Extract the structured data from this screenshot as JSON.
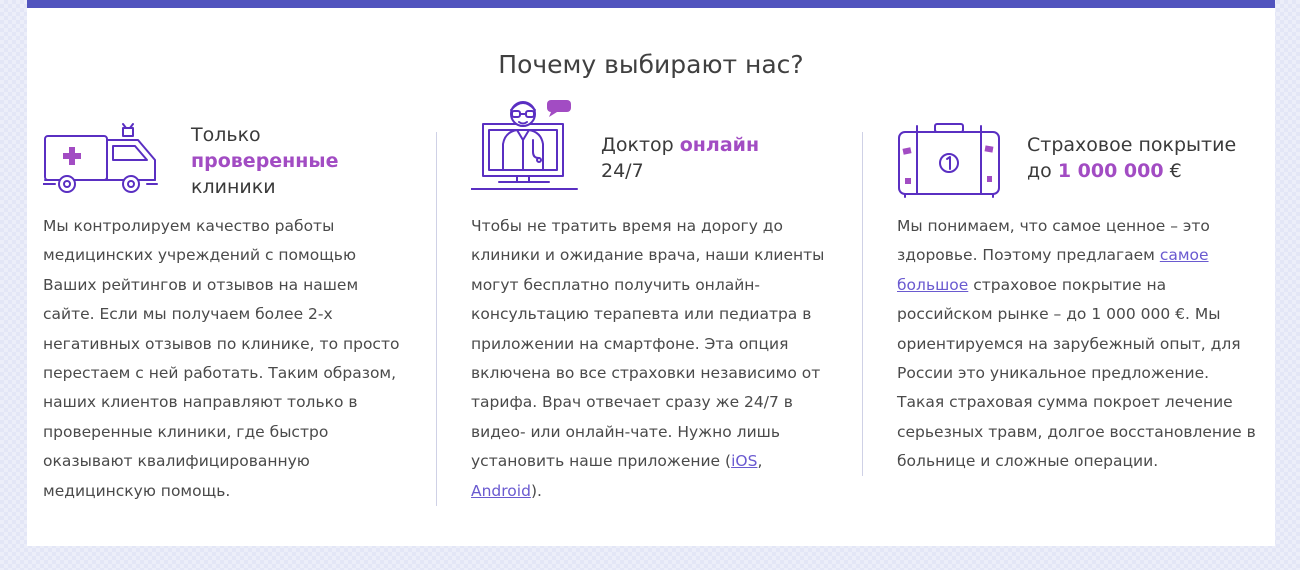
{
  "section": {
    "title": "Почему выбирают нас?"
  },
  "features": [
    {
      "icon": "ambulance-icon",
      "title_line1": "Только",
      "title_accent": "проверенные",
      "title_line3": "клиники",
      "lines": [
        "Мы контролируем качество работы",
        "медицинских учреждений с помощью",
        "Ваших рейтингов и отзывов на нашем",
        "сайте. Если мы получаем более 2-х",
        "негативных отзывов по клинике, то просто",
        "перестаем с ней работать. Таким образом,",
        "наших клиентов направляют только в",
        "проверенные клиники, где быстро",
        "оказывают квалифицированную",
        "медицинскую помощь."
      ]
    },
    {
      "icon": "doctor-monitor-icon",
      "title_plain": "Доктор ",
      "title_accent": "онлайн",
      "title_line2": "24/7",
      "lines": [
        "Чтобы не тратить время на дорогу до",
        "клиники и ожидание врача, наши клиенты",
        "могут бесплатно получить онлайн-",
        "консультацию терапевта или педиатра в",
        "приложении на смартфоне. Эта опция",
        "включена во все страховки независимо от",
        "тарифа. Врач отвечает сразу же 24/7 в",
        "видео- или онлайн-чате. Нужно лишь"
      ],
      "line9_prefix": "установить наше приложение (",
      "link_ios": "iOS",
      "line9_suffix": ",",
      "link_android": "Android",
      "line10_suffix": ")."
    },
    {
      "icon": "suitcase-icon",
      "title_line1": "Страховое покрытие",
      "title_prefix": "до ",
      "title_accent": "1 000 000",
      "title_suffix": " €",
      "line1": "Мы понимаем, что самое ценное – это",
      "line2_prefix": "здоровье. Поэтому предлагаем ",
      "link_part1": "самое",
      "link_part2": "большое",
      "line3_suffix": " страховое покрытие на",
      "lines": [
        "российском рынке – до 1 000 000 €. Мы",
        "ориентируемся на зарубежный опыт, для",
        "России это уникальное предложение.",
        "Такая страховая сумма покроет лечение",
        "серьезных травм, долгое восстановление в",
        "больнице и сложные операции."
      ]
    }
  ],
  "colors": {
    "accent": "#a24cc3",
    "brand_bar": "#5154be",
    "icon_stroke": "#5a2fc2",
    "link": "#6a5ad0"
  }
}
